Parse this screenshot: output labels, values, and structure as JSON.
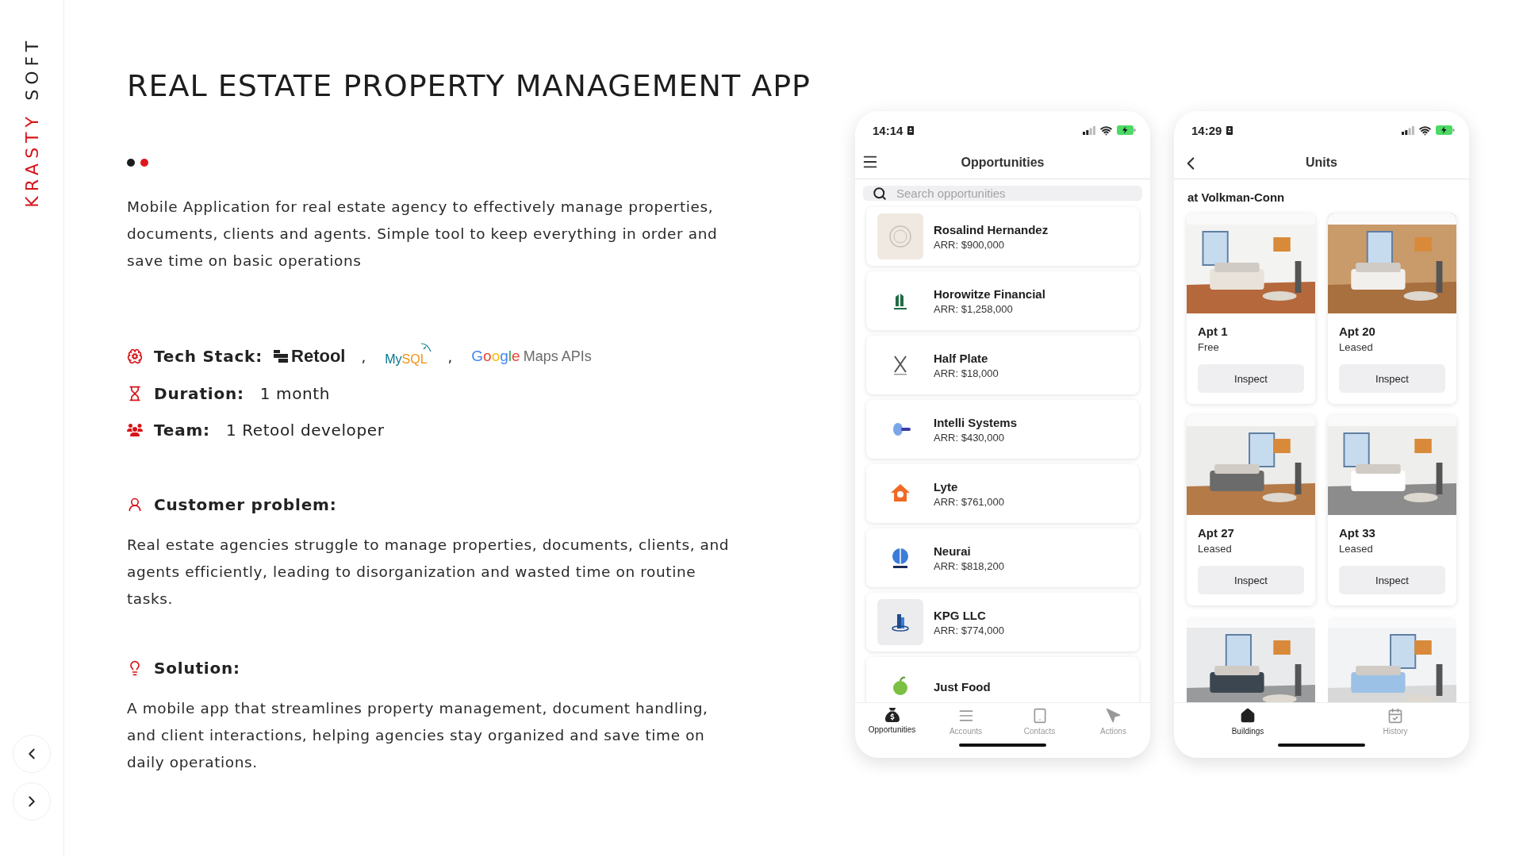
{
  "logo": [
    {
      "text": "KRASTY",
      "color": "#d7141a"
    },
    {
      "text": "SOFT",
      "color": "#222222"
    }
  ],
  "title": "REAL ESTATE PROPERTY MANAGEMENT APP",
  "slide_dots": [
    {
      "selected": false
    },
    {
      "selected": true
    }
  ],
  "intro": "Mobile Application for real estate agency to effectively manage properties, documents, clients and agents. Simple tool to keep everything in order and save time on basic operations",
  "facts": [
    {
      "kind": "tech_stack",
      "label": "Tech Stack:",
      "logos": [
        {
          "kind": "retool",
          "text": "Retool",
          "separator": ","
        },
        {
          "kind": "mysql",
          "text": "MySQL",
          "separator": ","
        },
        {
          "kind": "google_maps",
          "brand": "Google",
          "text": "Maps APIs"
        }
      ]
    },
    {
      "kind": "duration",
      "label": "Duration:",
      "value": "1 month"
    },
    {
      "kind": "team",
      "label": "Team:",
      "value": "1 Retool developer"
    }
  ],
  "sections": [
    {
      "kind": "problem",
      "heading": "Customer problem:",
      "text": "Real estate agencies struggle to manage properties, documents, clients, and agents efficiently, leading to disorganization and wasted time on routine tasks."
    },
    {
      "kind": "solution",
      "heading": "Solution:",
      "text": "A mobile app that streamlines property management, document handling, and client interactions, helping agencies stay organized and save time on daily operations."
    }
  ],
  "phones": [
    {
      "kind": "list",
      "time": "14:14",
      "title": "Opportunities",
      "search": {
        "placeholder": "Search opportunities"
      },
      "items": [
        {
          "name": "Rosalind Hernandez",
          "arr": "ARR: $900,000"
        },
        {
          "name": "Horowitze Financial",
          "arr": "ARR: $1,258,000"
        },
        {
          "name": "Half Plate",
          "arr": "ARR: $18,000"
        },
        {
          "name": "Intelli Systems",
          "arr": "ARR: $430,000"
        },
        {
          "name": "Lyte",
          "arr": "ARR: $761,000"
        },
        {
          "name": "Neurai",
          "arr": "ARR: $818,200"
        },
        {
          "name": "KPG LLC",
          "arr": "ARR: $774,000"
        },
        {
          "name": "Just Food"
        }
      ],
      "tabs": [
        {
          "label": "Opportunities",
          "selected": true
        },
        {
          "label": "Accounts",
          "selected": false
        },
        {
          "label": "Contacts",
          "selected": false
        },
        {
          "label": "Actions",
          "selected": false
        }
      ]
    },
    {
      "kind": "grid",
      "time": "14:29",
      "title": "Units",
      "subtitle": "at Volkman-Conn",
      "units": [
        {
          "kind": "unit",
          "name": "Apt 1",
          "status": "Free",
          "button": "Inspect"
        },
        {
          "kind": "unit",
          "name": "Apt 20",
          "status": "Leased",
          "button": "Inspect"
        },
        {
          "kind": "unit",
          "name": "Apt 27",
          "status": "Leased",
          "button": "Inspect"
        },
        {
          "kind": "unit",
          "name": "Apt 33",
          "status": "Leased",
          "button": "Inspect"
        },
        {
          "kind": "picture"
        },
        {
          "kind": "picture"
        }
      ],
      "tabs": [
        {
          "label": "Buildings",
          "selected": true
        },
        {
          "label": "History",
          "selected": false
        }
      ]
    }
  ]
}
